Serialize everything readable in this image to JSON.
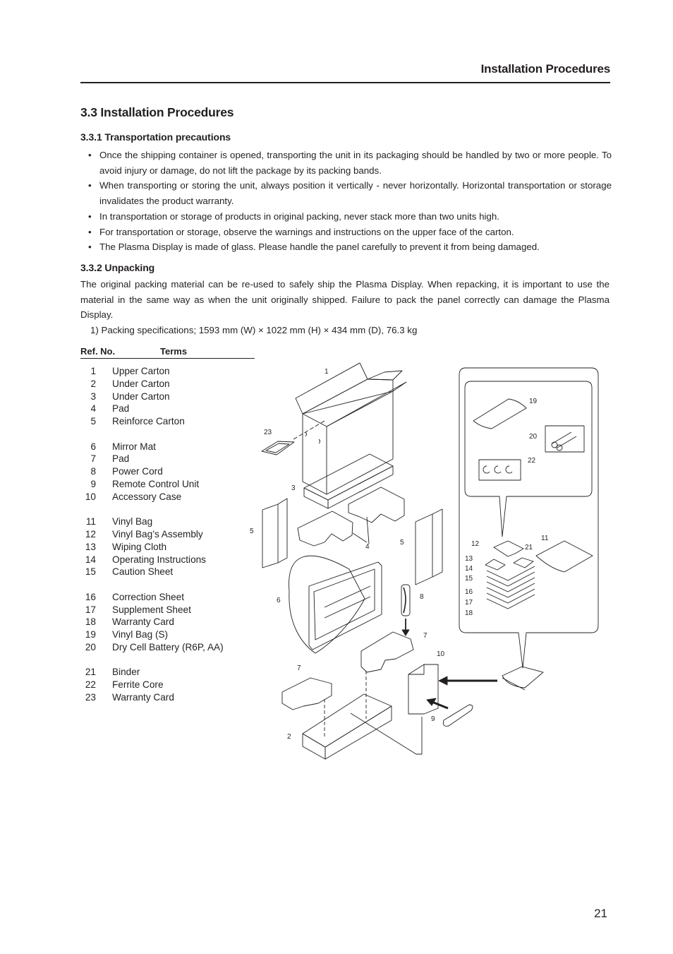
{
  "header": {
    "running_title": "Installation Procedures"
  },
  "section": {
    "title": "3.3 Installation Procedures",
    "subsections": [
      {
        "title": "3.3.1 Transportation precautions",
        "bullets": [
          "Once the shipping container is opened, transporting the unit in its packaging should be handled by two or more people. To avoid injury or damage, do not lift the package by its packing bands.",
          "When transporting or storing the unit, always position it vertically - never horizontally. Horizontal transportation or storage invalidates the product warranty.",
          "In transportation or storage of products in original packing, never stack more than two units high.",
          "For transportation or storage, observe the warnings and instructions on the upper face of the carton.",
          "The Plasma Display is made of glass. Please handle the panel carefully to prevent it from being damaged."
        ]
      },
      {
        "title": "3.3.2 Unpacking",
        "paragraph": "The original packing material can be re-used to safely ship the Plasma Display. When repacking, it is important to use the material in the same way as when the unit originally shipped. Failure to pack the panel correctly can damage the Plasma Display.",
        "spec": "1)  Packing specifications; 1593 mm (W) × 1022 mm (H) × 434 mm (D), 76.3 kg"
      }
    ]
  },
  "parts_table": {
    "headers": {
      "ref": "Ref. No.",
      "terms": "Terms"
    },
    "groups": [
      [
        {
          "ref": "1",
          "term": "Upper Carton"
        },
        {
          "ref": "2",
          "term": "Under Carton"
        },
        {
          "ref": "3",
          "term": "Under Carton"
        },
        {
          "ref": "4",
          "term": "Pad"
        },
        {
          "ref": "5",
          "term": "Reinforce Carton"
        }
      ],
      [
        {
          "ref": "6",
          "term": "Mirror Mat"
        },
        {
          "ref": "7",
          "term": "Pad"
        },
        {
          "ref": "8",
          "term": "Power Cord"
        },
        {
          "ref": "9",
          "term": "Remote Control Unit"
        },
        {
          "ref": "10",
          "term": "Accessory Case"
        }
      ],
      [
        {
          "ref": "11",
          "term": "Vinyl Bag"
        },
        {
          "ref": "12",
          "term": "Vinyl Bag’s Assembly"
        },
        {
          "ref": "13",
          "term": "Wiping Cloth"
        },
        {
          "ref": "14",
          "term": "Operating Instructions"
        },
        {
          "ref": "15",
          "term": "Caution Sheet"
        }
      ],
      [
        {
          "ref": "16",
          "term": "Correction Sheet"
        },
        {
          "ref": "17",
          "term": "Supplement Sheet"
        },
        {
          "ref": "18",
          "term": "Warranty Card"
        },
        {
          "ref": "19",
          "term": "Vinyl Bag (S)"
        },
        {
          "ref": "20",
          "term": "Dry Cell Battery (R6P, AA)"
        }
      ],
      [
        {
          "ref": "21",
          "term": "Binder"
        },
        {
          "ref": "22",
          "term": "Ferrite Core"
        },
        {
          "ref": "23",
          "term": "Warranty Card"
        }
      ]
    ]
  },
  "diagram": {
    "callouts": [
      "1",
      "2",
      "3",
      "4",
      "5",
      "5",
      "6",
      "7",
      "7",
      "8",
      "9",
      "10",
      "11",
      "12",
      "13",
      "14",
      "15",
      "16",
      "17",
      "18",
      "19",
      "20",
      "21",
      "22",
      "23"
    ]
  },
  "footer": {
    "page_number": "21"
  }
}
